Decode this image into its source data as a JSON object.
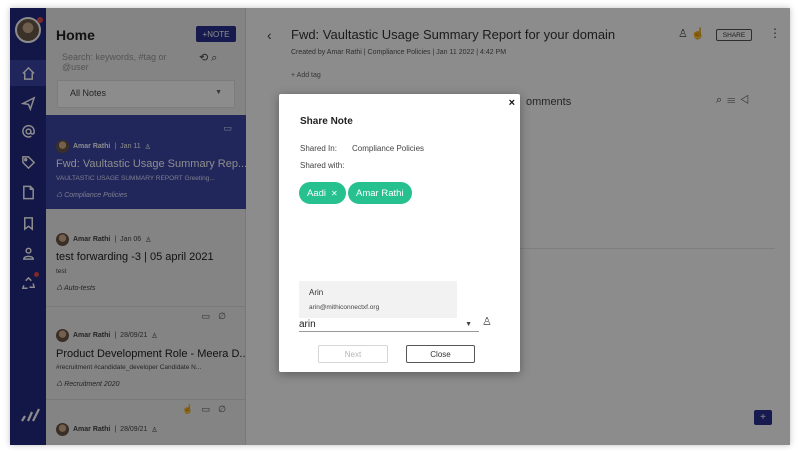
{
  "rail": {
    "items": [
      {
        "icon": "home-icon",
        "active": true
      },
      {
        "icon": "send-icon"
      },
      {
        "icon": "at-icon"
      },
      {
        "icon": "tag-icon"
      },
      {
        "icon": "document-icon"
      },
      {
        "icon": "bookmark-icon"
      },
      {
        "icon": "contacts-icon"
      },
      {
        "icon": "recycle-icon"
      }
    ]
  },
  "list": {
    "title": "Home",
    "new_note_label": "+NOTE",
    "search_placeholder": "Search: keywords, #tag or @user",
    "filter_value": "All Notes",
    "cards": [
      {
        "author": "Amar Rathi",
        "date": "Jan 11",
        "title": "Fwd: Vaultastic Usage Summary Rep...",
        "snippet": "VAULTASTIC USAGE SUMMARY REPORT Greeting...",
        "tag": "Compliance Policies",
        "selected": true
      },
      {
        "author": "Amar Rathi",
        "date": "Jan 06",
        "title": "test forwarding -3 | 05 april 2021",
        "snippet": "test",
        "tag": "Auto-tests",
        "selected": false
      },
      {
        "author": "Amar Rathi",
        "date": "28/09/21",
        "title": "Product Development Role - Meera D...",
        "snippet": "#recruitment #candidate_developer Candidate N...",
        "tag": "Recruitment 2020",
        "selected": false
      },
      {
        "author": "Amar Rathi",
        "date": "28/09/21",
        "title": "",
        "snippet": "",
        "tag": "",
        "selected": false
      }
    ]
  },
  "main": {
    "title": "Fwd: Vaultastic Usage Summary Report for your domain",
    "created_by": "Created by  Amar Rathi  |  Compliance Policies  |  Jan 11 2022 | 4:42 PM",
    "add_tag": "+ Add tag",
    "share_label": "SHARE",
    "comments_label": "omments"
  },
  "modal": {
    "title": "Share Note",
    "shared_in_label": "Shared In:",
    "shared_in_value": "Compliance Policies",
    "shared_with_label": "Shared with:",
    "chips": [
      {
        "name": "Aadi",
        "removable": true
      },
      {
        "name": "Amar Rathi",
        "removable": false
      }
    ],
    "suggestion": {
      "name": "Arin",
      "email": "arin@mithiconnectxf.org"
    },
    "input_value": "arin",
    "next_label": "Next",
    "close_label": "Close",
    "close_x": "×"
  },
  "colors": {
    "rail": "#232a82",
    "selected_card": "#3c46a7",
    "chip": "#27c08f"
  }
}
